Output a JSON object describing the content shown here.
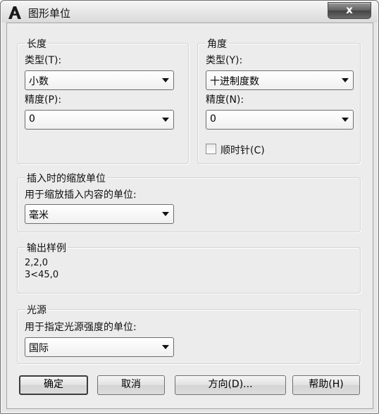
{
  "window": {
    "title": "图形单位",
    "close_label": "x"
  },
  "length": {
    "group_label": "长度",
    "type_label": "类型(T):",
    "type_value": "小数",
    "precision_label": "精度(P):",
    "precision_value": "0"
  },
  "angle": {
    "group_label": "角度",
    "type_label": "类型(Y):",
    "type_value": "十进制度数",
    "precision_label": "精度(N):",
    "precision_value": "0",
    "clockwise_label": "顺时针(C)",
    "clockwise_checked": false
  },
  "insertion": {
    "group_label": "插入时的缩放单位",
    "desc_label": "用于缩放插入内容的单位:",
    "units_value": "毫米"
  },
  "sample_output": {
    "group_label": "输出样例",
    "line1": "2,2,0",
    "line2": "3<45,0"
  },
  "lighting": {
    "group_label": "光源",
    "desc_label": "用于指定光源强度的单位:",
    "units_value": "国际"
  },
  "buttons": {
    "ok": "确定",
    "cancel": "取消",
    "direction": "方向(D)...",
    "help": "帮助(H)"
  },
  "icons": {
    "app": "autocad-a-icon",
    "close": "close-icon",
    "dropdown": "chevron-down-icon"
  }
}
